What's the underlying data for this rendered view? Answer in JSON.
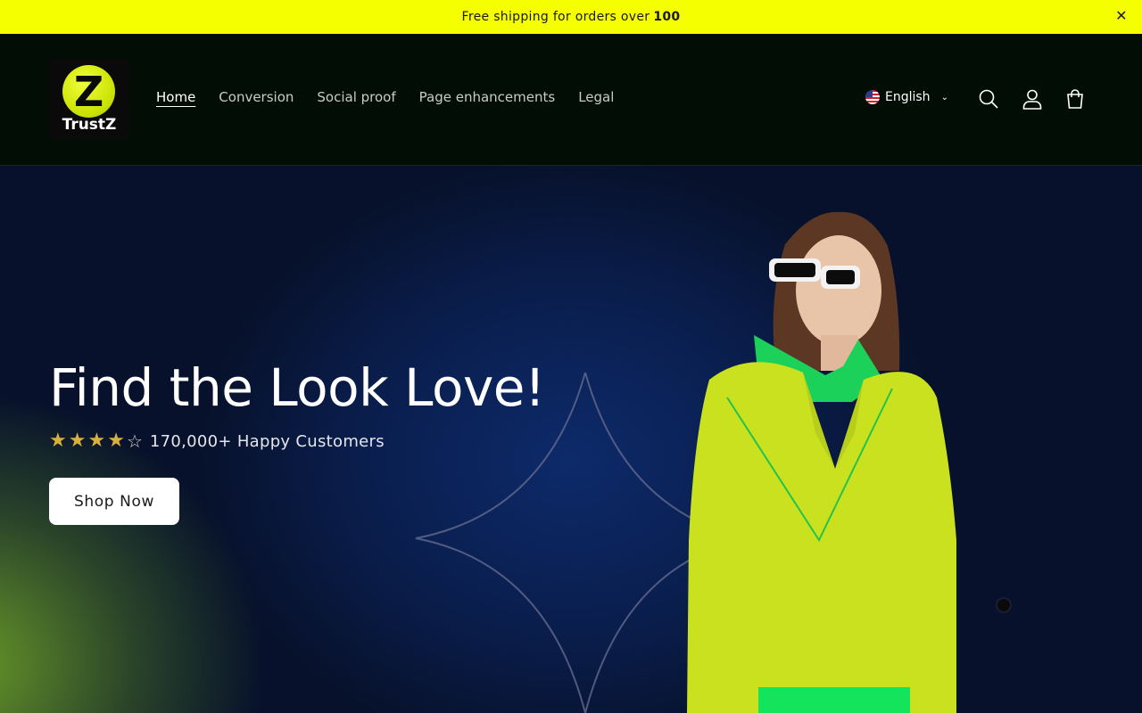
{
  "announcement": {
    "text": "Free shipping for orders over",
    "amount": "100",
    "close_icon": "close-icon"
  },
  "header": {
    "logo_text": "TrustZ",
    "logo_mark": "Z",
    "nav": [
      {
        "label": "Home",
        "active": true
      },
      {
        "label": "Conversion",
        "active": false
      },
      {
        "label": "Social proof",
        "active": false
      },
      {
        "label": "Page enhancements",
        "active": false
      },
      {
        "label": "Legal",
        "active": false
      }
    ],
    "language": "English",
    "icons": [
      "search-icon",
      "account-icon",
      "cart-icon"
    ]
  },
  "hero": {
    "title": "Find the Look Love!",
    "rating_value": 4,
    "rating_max": 5,
    "rating_text": "170,000+ Happy Customers",
    "cta_label": "Shop Now"
  },
  "colors": {
    "announcement_bg": "#f5ff00",
    "header_bg": "#010d05",
    "star": "#d7b13c",
    "sweater": "#c9e11f",
    "collar": "#1bd15a"
  }
}
